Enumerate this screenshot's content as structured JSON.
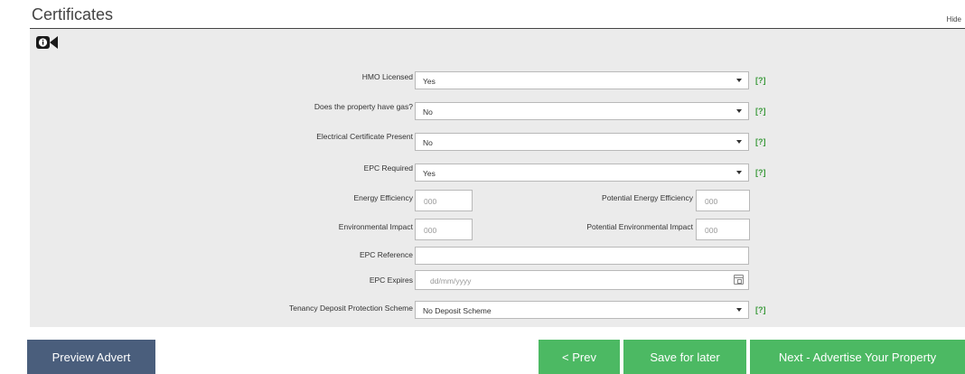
{
  "header": {
    "title": "Certificates",
    "hide_label": "Hide"
  },
  "icons": {
    "video": "video-camera-info-icon",
    "calendar": "calendar-icon",
    "dropdown": "chevron-down-icon"
  },
  "fields": {
    "hmo_licensed": {
      "label": "HMO Licensed",
      "value": "Yes",
      "help": "[?]"
    },
    "property_gas": {
      "label": "Does the property have gas?",
      "value": "No",
      "help": "[?]"
    },
    "electrical_certificate": {
      "label": "Electrical Certificate Present",
      "value": "No",
      "help": "[?]"
    },
    "epc_required": {
      "label": "EPC Required",
      "value": "Yes",
      "help": "[?]"
    },
    "energy_efficiency": {
      "label": "Energy Efficiency",
      "placeholder": "000"
    },
    "potential_energy_efficiency": {
      "label": "Potential Energy Efficiency",
      "placeholder": "000"
    },
    "environmental_impact": {
      "label": "Environmental Impact",
      "placeholder": "000"
    },
    "potential_environmental_impact": {
      "label": "Potential Environmental Impact",
      "placeholder": "000"
    },
    "epc_reference": {
      "label": "EPC Reference",
      "value": ""
    },
    "epc_expires": {
      "label": "EPC Expires",
      "placeholder": "dd/mm/yyyy"
    },
    "deposit_scheme": {
      "label": "Tenancy Deposit Protection Scheme",
      "value": "No Deposit Scheme",
      "help": "[?]"
    }
  },
  "buttons": {
    "preview": "Preview Advert",
    "prev": "< Prev",
    "save": "Save for later",
    "next": "Next - Advertise Your Property"
  },
  "colors": {
    "panel_bg": "#ebebeb",
    "green": "#4cb963",
    "navy": "#4a5e7c",
    "help_green": "#3c9a3c"
  }
}
